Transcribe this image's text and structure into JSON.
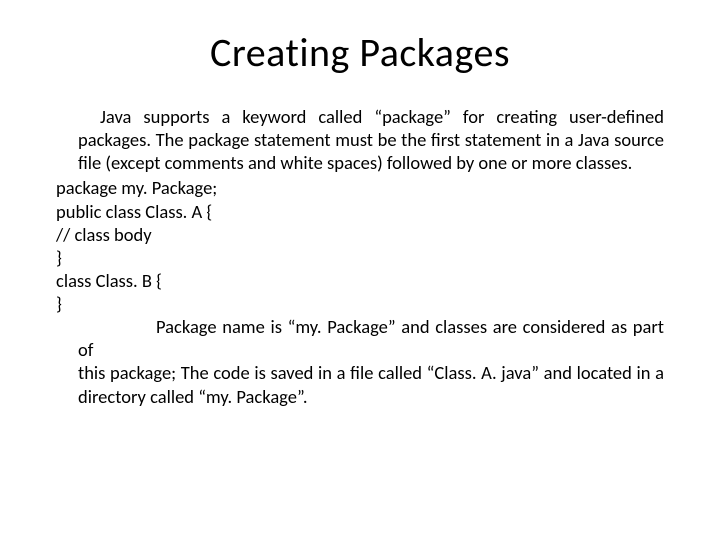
{
  "title": "Creating Packages",
  "para1": "Java supports a keyword called “package” for creating user-defined packages. The package statement must be the first statement in a Java source file (except comments and white spaces) followed by one or more classes.",
  "code": {
    "l1": "package my. Package;",
    "l2": "public class Class. A {",
    "l3": "// class body",
    "l4": "}",
    "l5": "class Class. B {",
    "l6": "}"
  },
  "para2a": "Package name is “my. Package” and classes are considered as part of",
  "para2b": "this package; The code is saved in a file called “Class. A. java” and located in a directory  called “my. Package”."
}
